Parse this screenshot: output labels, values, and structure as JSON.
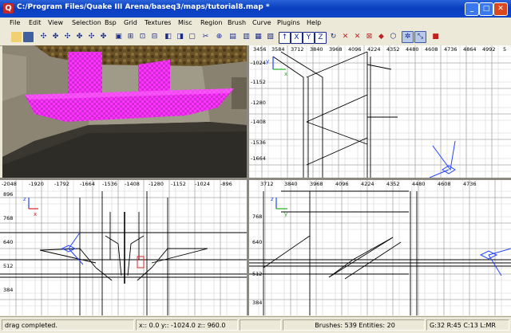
{
  "window": {
    "title": "C:/Program Files/Quake III Arena/baseq3/maps/tutorial8.map *",
    "controls": {
      "minimize": "_",
      "maximize": "□",
      "close": "✕"
    }
  },
  "menu": [
    "File",
    "Edit",
    "View",
    "Selection",
    "Bsp",
    "Grid",
    "Textures",
    "Misc",
    "Region",
    "Brush",
    "Curve",
    "Plugins",
    "Help"
  ],
  "toolbar": {
    "icons": [
      "open-file",
      "save-file",
      "x-axis-flip",
      "x-axis-rotate",
      "y-axis-flip",
      "y-axis-rotate",
      "z-axis-flip",
      "z-axis-rotate",
      "complete-tall",
      "size-to-fit",
      "select-touching",
      "select-partial",
      "csg-subtract",
      "csg-merge",
      "hollow",
      "clipper",
      "change-views",
      "camera-preview",
      "select-x",
      "select-y",
      "select-z",
      "view-x",
      "view-y",
      "view-z",
      "texture-lock",
      "free-rotate",
      "scale",
      "brush-entities",
      "patch-mode",
      "show-patch-bounding",
      "cube-clip",
      "bend-mode",
      "select-by-curve",
      "plugin-a",
      "plugin-b"
    ]
  },
  "views": {
    "top_right": {
      "plane": "XY",
      "h_ticks": [
        "3456",
        "3584",
        "3712",
        "3840",
        "3968",
        "4096",
        "4224",
        "4352",
        "4480",
        "4608",
        "4736",
        "4864",
        "4992",
        "5"
      ],
      "v_ticks": [
        "-1024",
        "-1152",
        "-1280",
        "-1408",
        "-1536",
        "-1664"
      ],
      "axis_x": "x",
      "axis_y": "y"
    },
    "bottom_left": {
      "plane": "XZ",
      "h_ticks": [
        "-2048",
        "-1920",
        "-1792",
        "-1664",
        "-1536",
        "-1408",
        "-1280",
        "-1152",
        "-1024",
        "-896"
      ],
      "v_ticks": [
        "896",
        "768",
        "640",
        "512",
        "384"
      ],
      "axis_x": "x",
      "axis_y": "z"
    },
    "bottom_right": {
      "plane": "YZ",
      "h_ticks": [
        "3712",
        "3840",
        "3968",
        "4096",
        "4224",
        "4352",
        "4480",
        "4608",
        "4736"
      ],
      "v_ticks": [
        "768",
        "640",
        "512",
        "384"
      ],
      "axis_x": "y",
      "axis_y": "z"
    }
  },
  "status": {
    "message": "drag completed.",
    "coords": "x:: 0.0  y:: -1024.0  z:: 960.0",
    "counts": "Brushes: 539 Entities: 20",
    "grid": "G:32 R:45 C:13 L:MR"
  },
  "colors": {
    "title_blue": "#0a3fbf",
    "brush_magenta": "#ff33ff",
    "brush_light": "#e066e0",
    "grid_line": "#c8c8c8",
    "camera_blue": "#2244ff",
    "selection_red": "#e02020",
    "axis_green": "#20b020"
  }
}
